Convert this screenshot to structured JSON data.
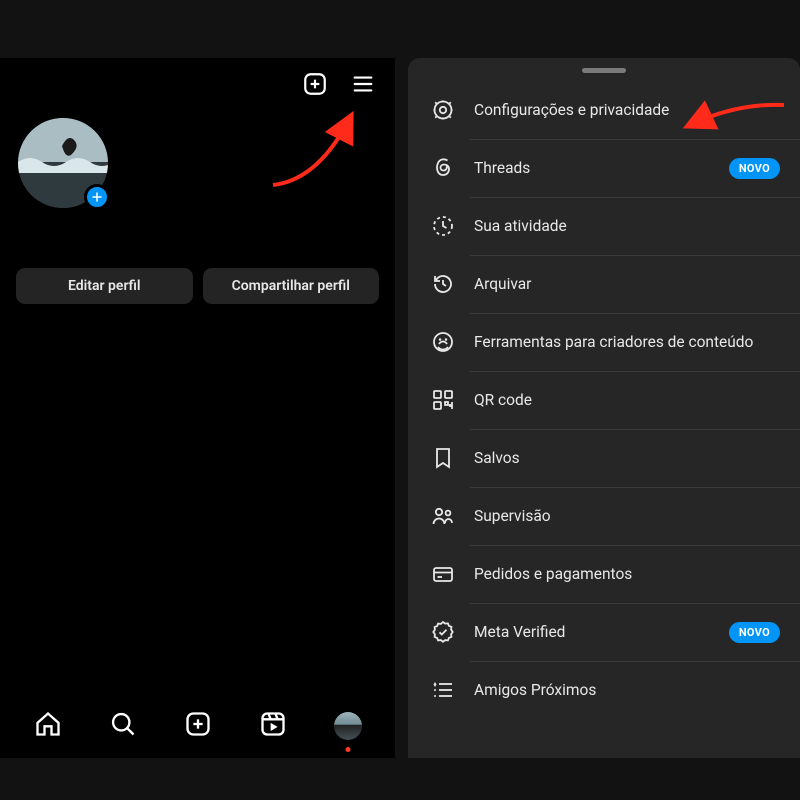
{
  "profile": {
    "edit_label": "Editar perfil",
    "share_label": "Compartilhar perfil"
  },
  "badge": {
    "novo": "NOVO"
  },
  "menu": {
    "items": [
      {
        "icon": "gear",
        "label": "Configurações e privacidade",
        "badge": null
      },
      {
        "icon": "threads",
        "label": "Threads",
        "badge": "novo"
      },
      {
        "icon": "clock",
        "label": "Sua atividade",
        "badge": null
      },
      {
        "icon": "history",
        "label": "Arquivar",
        "badge": null
      },
      {
        "icon": "creator",
        "label": "Ferramentas para criadores de conteúdo",
        "badge": null
      },
      {
        "icon": "qr",
        "label": "QR code",
        "badge": null
      },
      {
        "icon": "bookmark",
        "label": "Salvos",
        "badge": null
      },
      {
        "icon": "supervision",
        "label": "Supervisão",
        "badge": null
      },
      {
        "icon": "card",
        "label": "Pedidos e pagamentos",
        "badge": null
      },
      {
        "icon": "verified",
        "label": "Meta Verified",
        "badge": "novo"
      },
      {
        "icon": "closefriends",
        "label": "Amigos Próximos",
        "badge": null
      }
    ]
  }
}
